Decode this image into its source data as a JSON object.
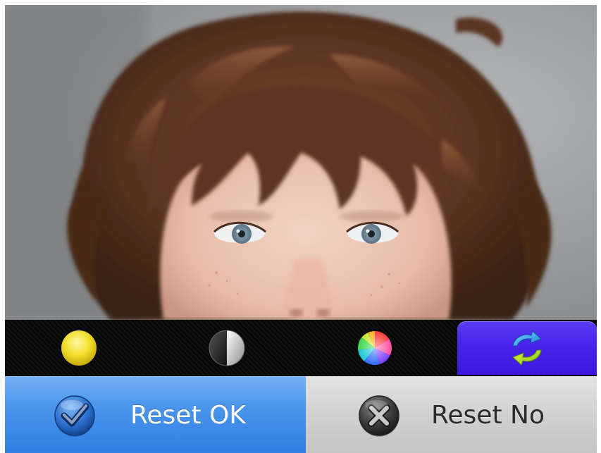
{
  "photo": {
    "subject": "child-portrait"
  },
  "toolbar": {
    "tools": [
      {
        "icon": "brightness-icon",
        "color": "#f2df2a",
        "active": false
      },
      {
        "icon": "contrast-icon",
        "color": "#8c8c8c",
        "active": false
      },
      {
        "icon": "saturation-icon",
        "color": "#ff4fa3",
        "active": false
      },
      {
        "icon": "reset-arrows-icon",
        "color": "#4a2ae9",
        "active": true
      }
    ]
  },
  "actions": {
    "ok": {
      "label": "Reset OK",
      "icon": "checkmark-icon",
      "color": "#3a88e6"
    },
    "no": {
      "label": "Reset No",
      "icon": "close-x-icon",
      "color": "#cfcfcf"
    }
  }
}
